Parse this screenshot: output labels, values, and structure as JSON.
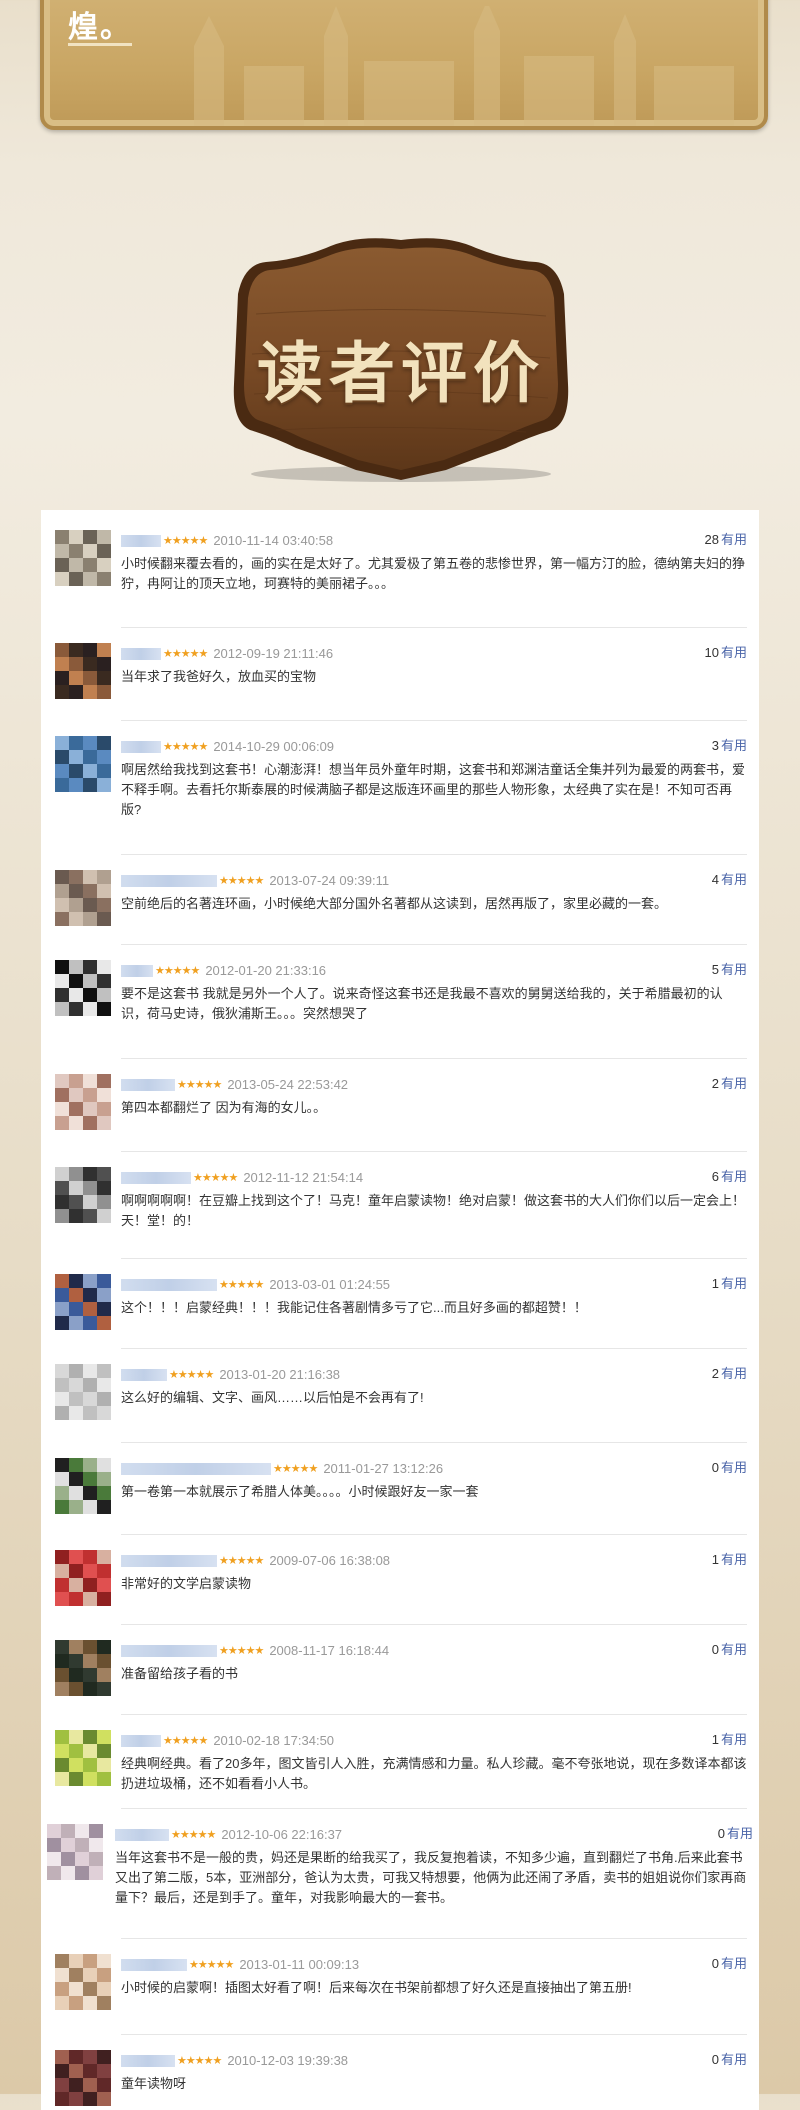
{
  "banner": {
    "text": "煌。"
  },
  "section_title": "读者评价",
  "colors": {
    "panel_bg": "#ffffff",
    "star": "#f0a020",
    "link": "#4a64a8",
    "wood": "#6b4321"
  },
  "icons": {
    "star": "star-icon",
    "avatar": "avatar-image"
  },
  "helpful_label": "有用",
  "reviews": [
    {
      "stars": "★★★★★",
      "date": "2010-11-14 03:40:58",
      "count": "28",
      "text": "小时候翻来覆去看的，画的实在是太好了。尤其爱极了第五卷的悲惨世界，第一幅方汀的脸，德纳第夫妇的狰狞，冉阿让的顶天立地，珂赛特的美丽裙子。。。"
    },
    {
      "stars": "★★★★★",
      "date": "2012-09-19 21:11:46",
      "count": "10",
      "text": "当年求了我爸好久，放血买的宝物"
    },
    {
      "stars": "★★★★★",
      "date": "2014-10-29 00:06:09",
      "count": "3",
      "text": "啊居然给我找到这套书！心潮澎湃！想当年员外童年时期，这套书和郑渊洁童话全集并列为最爱的两套书，爱不释手啊。去看托尔斯泰展的时候满脑子都是这版连环画里的那些人物形象，太经典了实在是！不知可否再版?"
    },
    {
      "stars": "★★★★★",
      "date": "2013-07-24 09:39:11",
      "count": "4",
      "text": "空前绝后的名著连环画，小时候绝大部分国外名著都从这读到，居然再版了，家里必藏的一套。"
    },
    {
      "stars": "★★★★★",
      "date": "2012-01-20 21:33:16",
      "count": "5",
      "text": "要不是这套书 我就是另外一个人了。说来奇怪这套书还是我最不喜欢的舅舅送给我的，关于希腊最初的认识，荷马史诗，俄狄浦斯王。。。突然想哭了"
    },
    {
      "stars": "★★★★★",
      "date": "2013-05-24 22:53:42",
      "count": "2",
      "text": "第四本都翻烂了 因为有海的女儿。。"
    },
    {
      "stars": "★★★★★",
      "date": "2012-11-12 21:54:14",
      "count": "6",
      "text": "啊啊啊啊啊！在豆瓣上找到这个了！马克！童年启蒙读物！绝对启蒙！做这套书的大人们你们以后一定会上！天！堂！的！"
    },
    {
      "stars": "★★★★★",
      "date": "2013-03-01 01:24:55",
      "count": "1",
      "text": "这个！！！启蒙经典！！！我能记住各著剧情多亏了它...而且好多画的都超赞！！"
    },
    {
      "stars": "★★★★★",
      "date": "2013-01-20 21:16:38",
      "count": "2",
      "text": "这么好的编辑、文字、画风……以后怕是不会再有了!"
    },
    {
      "stars": "★★★★★",
      "date": "2011-01-27 13:12:26",
      "count": "0",
      "text": "第一卷第一本就展示了希腊人体美。。。。小时候跟好友一家一套"
    },
    {
      "stars": "★★★★★",
      "date": "2009-07-06 16:38:08",
      "count": "1",
      "text": "非常好的文学启蒙读物"
    },
    {
      "stars": "★★★★★",
      "date": "2008-11-17 16:18:44",
      "count": "0",
      "text": "准备留给孩子看的书"
    },
    {
      "stars": "★★★★★",
      "date": "2010-02-18 17:34:50",
      "count": "1",
      "text": "经典啊经典。看了20多年，图文皆引人入胜，充满情感和力量。私人珍藏。毫不夸张地说，现在多数译本都该扔进垃圾桶，还不如看看小人书。"
    },
    {
      "stars": "★★★★★",
      "date": "2012-10-06 22:16:37",
      "count": "0",
      "text": "当年这套书不是一般的贵，妈还是果断的给我买了，我反复抱着读，不知多少遍，直到翻烂了书角.后来此套书又出了第二版，5本，亚洲部分，爸认为太贵，可我又特想要，他俩为此还闹了矛盾，卖书的姐姐说你们家再商量下？最后，还是到手了。童年，对我影响最大的一套书。"
    },
    {
      "stars": "★★★★★",
      "date": "2013-01-11 00:09:13",
      "count": "0",
      "text": "小时候的启蒙啊！插图太好看了啊！后来每次在书架前都想了好久还是直接抽出了第五册!"
    },
    {
      "stars": "★★★★★",
      "date": "2010-12-03 19:39:38",
      "count": "0",
      "text": "童年读物呀"
    }
  ]
}
